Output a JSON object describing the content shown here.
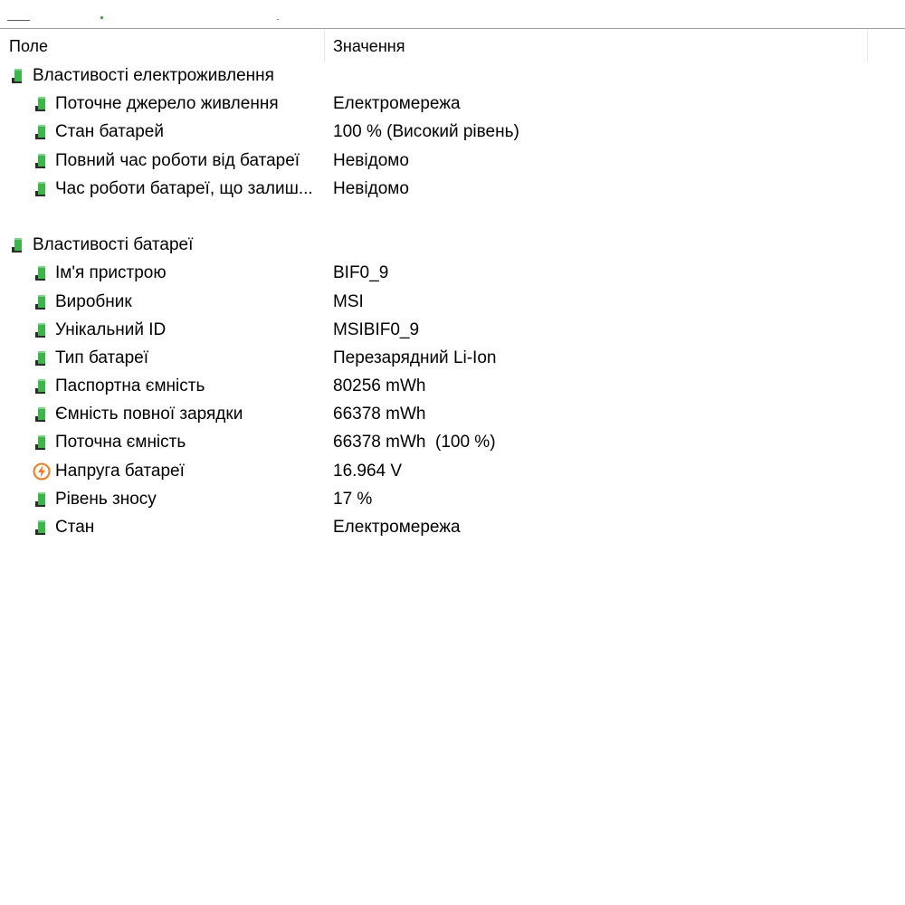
{
  "table": {
    "columns": {
      "field": "Поле",
      "value": "Значення"
    },
    "groups": [
      {
        "label": "Властивості електроживлення",
        "icon": "battery-icon",
        "rows": [
          {
            "label": "Поточне джерело живлення",
            "value": "Електромережа",
            "icon": "battery-icon"
          },
          {
            "label": "Стан батарей",
            "value": "100 % (Високий рівень)",
            "icon": "battery-icon"
          },
          {
            "label": "Повний час роботи від батареї",
            "value": "Невідомо",
            "icon": "battery-icon"
          },
          {
            "label": "Час роботи батареї, що залиш...",
            "value": "Невідомо",
            "icon": "battery-icon"
          }
        ]
      },
      {
        "label": "Властивості батареї",
        "icon": "battery-icon",
        "rows": [
          {
            "label": "Ім'я пристрою",
            "value": "BIF0_9",
            "icon": "battery-icon"
          },
          {
            "label": "Виробник",
            "value": "MSI",
            "icon": "battery-icon"
          },
          {
            "label": "Унікальний ID",
            "value": "MSIBIF0_9",
            "icon": "battery-icon"
          },
          {
            "label": "Тип батареї",
            "value": "Перезарядний Li-Ion",
            "icon": "battery-icon"
          },
          {
            "label": "Паспортна ємність",
            "value": "80256 mWh",
            "icon": "battery-icon"
          },
          {
            "label": "Ємність повної зарядки",
            "value": "66378 mWh",
            "icon": "battery-icon"
          },
          {
            "label": "Поточна ємність",
            "value": "66378 mWh  (100 %)",
            "icon": "battery-icon"
          },
          {
            "label": "Напруга батареї",
            "value": "16.964 V",
            "icon": "voltage-icon"
          },
          {
            "label": "Рівень зносу",
            "value": "17 %",
            "icon": "battery-icon"
          },
          {
            "label": "Стан",
            "value": "Електромережа",
            "icon": "battery-icon"
          }
        ]
      }
    ]
  },
  "colors": {
    "battery_green": "#3db54a",
    "battery_dark": "#2b2b2b",
    "voltage_orange": "#f07c1e",
    "header_separator": "#e5e5e5",
    "topbar_border": "#a0a0a0"
  }
}
